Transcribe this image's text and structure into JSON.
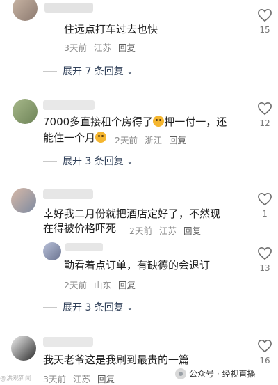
{
  "comments": [
    {
      "text_line1": "住远点打车过去也快",
      "meta": {
        "time": "3天前",
        "location": "江苏",
        "reply": "回复"
      },
      "likes": "15",
      "expand_label": "展开 7 条回复"
    },
    {
      "text_line1": "7000多直接租个房得了",
      "text_line1_tail": "押一付一，还",
      "text_line2": "能住一个月",
      "meta": {
        "time": "2天前",
        "location": "浙江",
        "reply": "回复"
      },
      "likes": "12",
      "expand_label": "展开 3 条回复"
    },
    {
      "text_line1": "幸好我二月份就把酒店定好了，不然现",
      "text_line2": "在得被价格吓死",
      "meta": {
        "time": "2天前",
        "location": "江苏",
        "reply": "回复"
      },
      "likes": "1",
      "reply": {
        "text": "勤看着点订单，有缺德的会退订",
        "meta": {
          "time": "2天前",
          "location": "山东",
          "reply": "回复"
        },
        "likes": "13"
      },
      "expand_label": "展开 3 条回复"
    },
    {
      "text_line1": "我天老爷这是我刷到最贵的一篇",
      "meta": {
        "time": "3天前",
        "location": "江苏",
        "reply": "回复"
      },
      "likes": "16"
    }
  ],
  "watermark": {
    "text": "公众号 · 经视直播",
    "left_mark": "@洪观新闻"
  },
  "colors": {
    "expand": "#2f3f58",
    "meta": "#8a8a8a",
    "heart": "#6f6f6f"
  }
}
